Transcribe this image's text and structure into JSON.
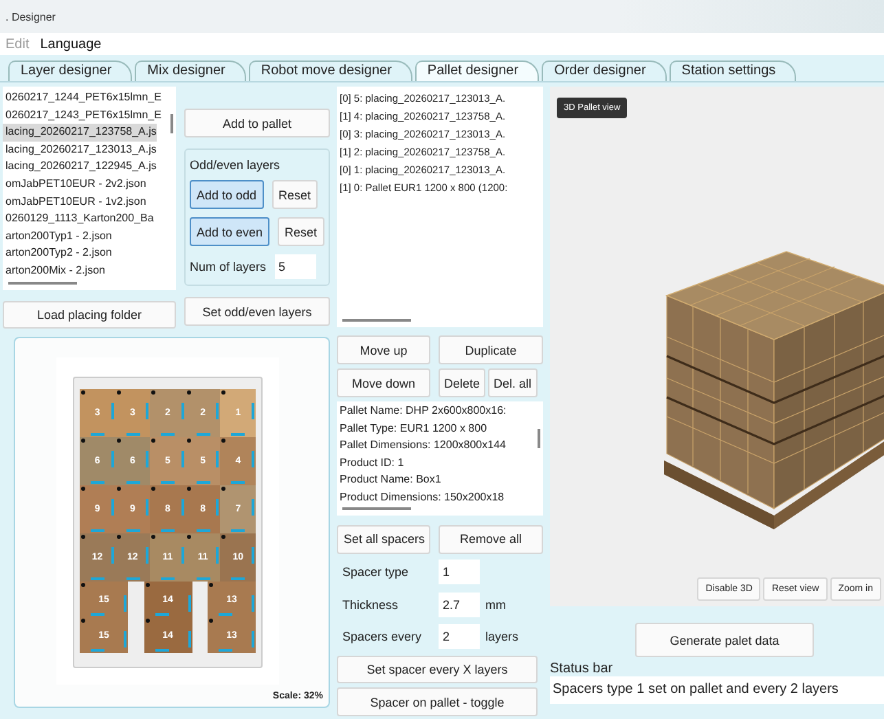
{
  "window": {
    "title": ". Designer"
  },
  "menu": [
    {
      "label": "Edit",
      "disabled": true
    },
    {
      "label": "Language",
      "disabled": false
    }
  ],
  "tabs": [
    {
      "label": "Layer designer",
      "selected": false
    },
    {
      "label": "Mix designer",
      "selected": false
    },
    {
      "label": "Robot move designer",
      "selected": false
    },
    {
      "label": "Pallet designer",
      "selected": true
    },
    {
      "label": "Order designer",
      "selected": false
    },
    {
      "label": "Station settings",
      "selected": false
    }
  ],
  "placing_list": {
    "items": [
      {
        "label": "0260217_1244_PET6x15lmn_E",
        "selected": false
      },
      {
        "label": "0260217_1243_PET6x15lmn_E",
        "selected": false
      },
      {
        "label": "lacing_20260217_123758_A.js",
        "selected": true
      },
      {
        "label": "lacing_20260217_123013_A.js",
        "selected": false
      },
      {
        "label": "lacing_20260217_122945_A.js",
        "selected": false
      },
      {
        "label": "omJabPET10EUR - 2v2.json",
        "selected": false
      },
      {
        "label": "omJabPET10EUR - 1v2.json",
        "selected": false
      },
      {
        "label": "0260129_1113_Karton200_Ba",
        "selected": false
      },
      {
        "label": "arton200Typ1 - 2.json",
        "selected": false
      },
      {
        "label": "arton200Typ2 - 2.json",
        "selected": false
      },
      {
        "label": "arton200Mix - 2.json",
        "selected": false
      }
    ]
  },
  "add_to_pallet": "Add to pallet",
  "odd_even": {
    "title": "Odd/even layers",
    "rows": [
      {
        "add": "Add to odd",
        "reset": "Reset"
      },
      {
        "add": "Add to even",
        "reset": "Reset"
      }
    ],
    "num_label": "Num of layers",
    "num_value": "5",
    "set_button": "Set odd/even layers"
  },
  "load_folder": "Load placing folder",
  "layer_preview": {
    "rows": [
      {
        "kind": "full",
        "tiles": [
          {
            "label": "3",
            "color": "#c2935f"
          },
          {
            "label": "3",
            "color": "#c2935f"
          },
          {
            "label": "2",
            "color": "#b2916a"
          },
          {
            "label": "2",
            "color": "#b2916a"
          },
          {
            "label": "1",
            "color": "#d2a977"
          }
        ]
      },
      {
        "kind": "full",
        "tiles": [
          {
            "label": "6",
            "color": "#a08a68"
          },
          {
            "label": "6",
            "color": "#a08a68"
          },
          {
            "label": "5",
            "color": "#b98f66"
          },
          {
            "label": "5",
            "color": "#b98f66"
          },
          {
            "label": "4",
            "color": "#b0845a"
          }
        ]
      },
      {
        "kind": "full",
        "tiles": [
          {
            "label": "9",
            "color": "#b07e55"
          },
          {
            "label": "9",
            "color": "#b07e55"
          },
          {
            "label": "8",
            "color": "#a8784f"
          },
          {
            "label": "8",
            "color": "#a8784f"
          },
          {
            "label": "7",
            "color": "#b09470"
          }
        ]
      },
      {
        "kind": "full",
        "tiles": [
          {
            "label": "12",
            "color": "#9a7a58"
          },
          {
            "label": "12",
            "color": "#9a7a58"
          },
          {
            "label": "11",
            "color": "#a88a62"
          },
          {
            "label": "11",
            "color": "#a88a62"
          },
          {
            "label": "10",
            "color": "#9a7450"
          }
        ]
      },
      {
        "kind": "gapped",
        "tiles": [
          {
            "label": "15",
            "color": "#a87a50"
          },
          {
            "label": "14",
            "color": "#9a6a40"
          },
          {
            "label": "13",
            "color": "#a87a50"
          }
        ]
      },
      {
        "kind": "gapped",
        "tiles": [
          {
            "label": "15",
            "color": "#a87a50"
          },
          {
            "label": "14",
            "color": "#9a6a40"
          },
          {
            "label": "13",
            "color": "#a87a50"
          }
        ]
      }
    ],
    "scale": "Scale: 32%"
  },
  "stack_list": {
    "items": [
      {
        "label": "[0] 5: placing_20260217_123013_A."
      },
      {
        "label": "[1] 4: placing_20260217_123758_A."
      },
      {
        "label": "[0] 3: placing_20260217_123013_A."
      },
      {
        "label": "[1] 2: placing_20260217_123758_A."
      },
      {
        "label": "[0] 1: placing_20260217_123013_A."
      },
      {
        "label": "[1] 0: Pallet EUR1 1200 x 800 (1200:"
      }
    ]
  },
  "stack_buttons": {
    "move_up": "Move up",
    "duplicate": "Duplicate",
    "move_down": "Move down",
    "delete": "Delete",
    "delete_all": "Del. all"
  },
  "info_lines": [
    "Pallet Name: DHP 2x600x800x16:",
    "Pallet Type: EUR1 1200 x 800",
    "Pallet Dimensions: 1200x800x144",
    "Product ID: 1",
    "Product Name: Box1",
    "Product Dimensions: 150x200x18"
  ],
  "spacers": {
    "set_all": "Set all spacers",
    "remove_all": "Remove all",
    "fields": [
      {
        "label": "Spacer type",
        "value": "1"
      },
      {
        "label": "Thickness",
        "value": "2.7",
        "unit": "mm"
      },
      {
        "label": "Spacers every",
        "value": "2",
        "unit": "layers"
      }
    ],
    "set_every": "Set spacer every X layers",
    "toggle": "Spacer on pallet - toggle"
  },
  "view3d": {
    "title": "3D Pallet view",
    "buttons": [
      "Disable 3D",
      "Reset view",
      "Zoom in"
    ]
  },
  "generate": "Generate palet data",
  "status_bar": {
    "label": "Status bar",
    "text": "Spacers type 1 set on pallet and every 2 layers"
  }
}
